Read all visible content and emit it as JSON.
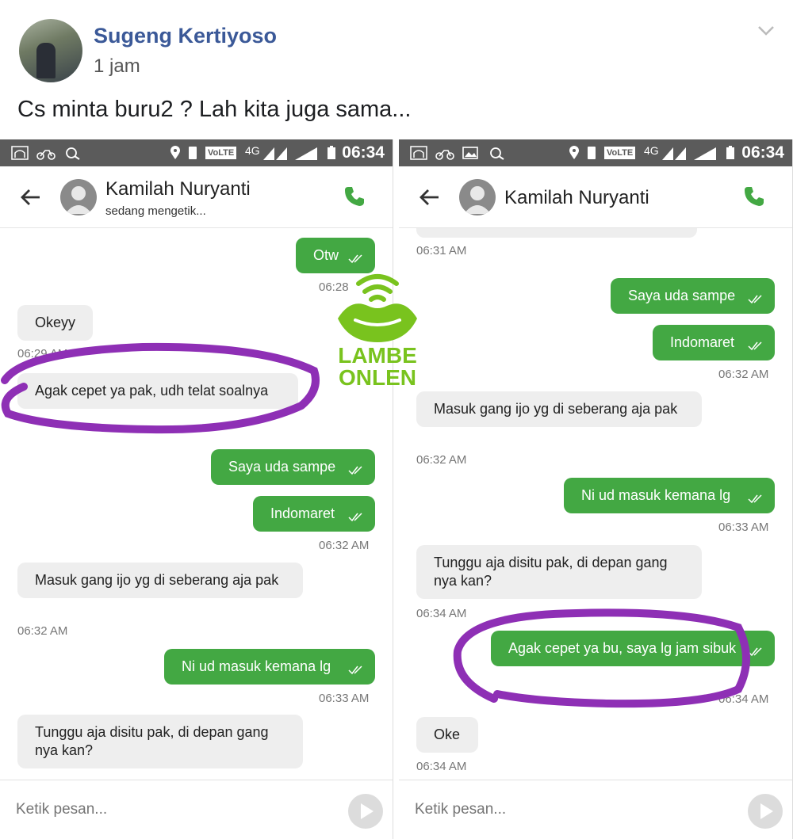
{
  "post": {
    "author": "Sugeng Kertiyoso",
    "time": "1 jam",
    "text": "Cs minta buru2 ? Lah kita juga sama..."
  },
  "watermark": {
    "line1": "LAMBE",
    "line2": "ONLEN"
  },
  "colors": {
    "outgoing_bubble": "#43a843",
    "incoming_bubble": "#eeeeee",
    "status_bar": "#5b5b5b",
    "highlight": "#8e2fb5",
    "facebook_name": "#3b5998"
  },
  "left_screen": {
    "status_time": "06:34",
    "status_network": "4G",
    "status_volte": "VoLTE",
    "contact_name": "Kamilah Nuryanti",
    "contact_status": "sedang mengetik...",
    "composer_placeholder": "Ketik pesan...",
    "messages": [
      {
        "dir": "out",
        "text": "Otw",
        "time": "06:28"
      },
      {
        "dir": "in",
        "text": "Okeyy",
        "time": "06:29 AM"
      },
      {
        "dir": "in",
        "text": "Agak cepet ya pak, udh telat soalnya",
        "time": ""
      },
      {
        "dir": "out",
        "text": "Saya uda sampe"
      },
      {
        "dir": "out",
        "text": "Indomaret",
        "time": "06:32 AM"
      },
      {
        "dir": "in",
        "text": "Masuk gang ijo yg di seberang aja pak",
        "time": "06:32 AM"
      },
      {
        "dir": "out",
        "text": "Ni ud masuk kemana lg",
        "time": "06:33 AM"
      },
      {
        "dir": "in",
        "text": "Tunggu aja disitu pak, di depan gang nya kan?"
      }
    ]
  },
  "right_screen": {
    "status_time": "06:34",
    "status_network": "4G",
    "status_volte": "VoLTE",
    "contact_name": "Kamilah Nuryanti",
    "composer_placeholder": "Ketik pesan...",
    "messages": [
      {
        "dir": "in",
        "text": "",
        "time": "06:31 AM"
      },
      {
        "dir": "out",
        "text": "Saya uda sampe"
      },
      {
        "dir": "out",
        "text": "Indomaret",
        "time": "06:32 AM"
      },
      {
        "dir": "in",
        "text": "Masuk gang ijo yg di seberang aja pak",
        "time": "06:32 AM"
      },
      {
        "dir": "out",
        "text": "Ni ud masuk kemana lg",
        "time": "06:33 AM"
      },
      {
        "dir": "in",
        "text": "Tunggu aja disitu pak, di depan gang nya kan?",
        "time": "06:34 AM"
      },
      {
        "dir": "out",
        "text": "Agak cepet ya bu,  saya lg jam sibuk",
        "time": "06:34 AM"
      },
      {
        "dir": "in",
        "text": "Oke",
        "time": "06:34 AM"
      }
    ]
  }
}
